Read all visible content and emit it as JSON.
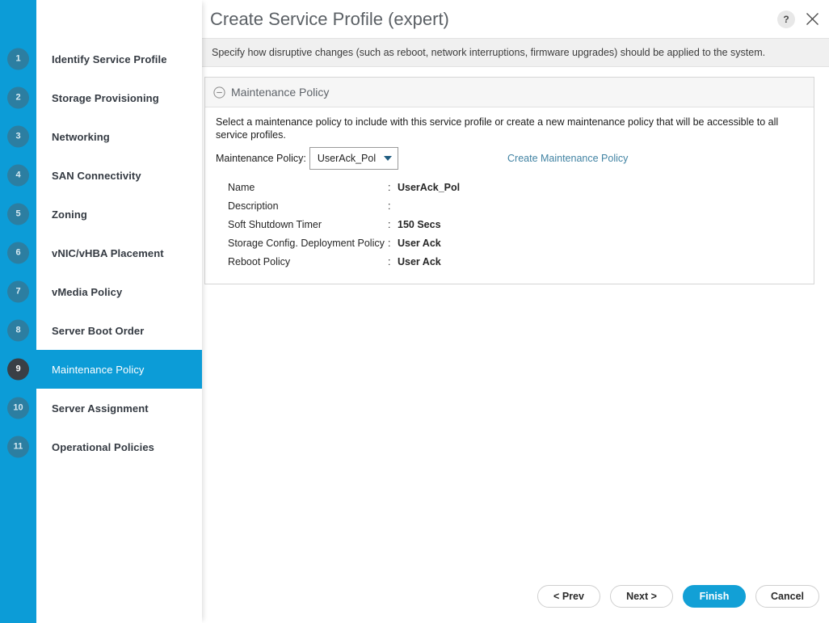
{
  "dialog": {
    "title": "Create Service Profile (expert)",
    "help_icon_label": "?",
    "subtitle": "Specify how disruptive changes (such as reboot, network interruptions, firmware upgrades) should be applied to the system."
  },
  "sidebar": {
    "steps": [
      {
        "num": "1",
        "label": "Identify Service Profile",
        "active": false
      },
      {
        "num": "2",
        "label": "Storage Provisioning",
        "active": false
      },
      {
        "num": "3",
        "label": "Networking",
        "active": false
      },
      {
        "num": "4",
        "label": "SAN Connectivity",
        "active": false
      },
      {
        "num": "5",
        "label": "Zoning",
        "active": false
      },
      {
        "num": "6",
        "label": "vNIC/vHBA Placement",
        "active": false
      },
      {
        "num": "7",
        "label": "vMedia Policy",
        "active": false
      },
      {
        "num": "8",
        "label": "Server Boot Order",
        "active": false
      },
      {
        "num": "9",
        "label": "Maintenance Policy",
        "active": true
      },
      {
        "num": "10",
        "label": "Server Assignment",
        "active": false
      },
      {
        "num": "11",
        "label": "Operational Policies",
        "active": false
      }
    ]
  },
  "panel": {
    "title": "Maintenance Policy",
    "description": "Select a maintenance policy to include with this service profile or create a new maintenance policy that will be accessible to all service profiles.",
    "selector_label": "Maintenance Policy:",
    "selected_policy": "UserAck_Pol",
    "create_link": "Create Maintenance Policy",
    "details": [
      {
        "key": "Name",
        "colon": ":",
        "value": "UserAck_Pol"
      },
      {
        "key": "Description",
        "colon": ":",
        "value": ""
      },
      {
        "key": "Soft Shutdown Timer",
        "colon": ":",
        "value": "150 Secs"
      },
      {
        "key": "Storage Config. Deployment Policy",
        "colon": ":",
        "value": "User Ack"
      },
      {
        "key": "Reboot Policy",
        "colon": ":",
        "value": "User Ack"
      }
    ]
  },
  "footer": {
    "prev": "< Prev",
    "next": "Next >",
    "finish": "Finish",
    "cancel": "Cancel"
  },
  "colors": {
    "accent_cyan": "#0c9cd7",
    "primary_button": "#12a0d6",
    "active_badge": "#3a3f45",
    "inactive_badge": "#2c7ea1",
    "link": "#4183a3"
  }
}
